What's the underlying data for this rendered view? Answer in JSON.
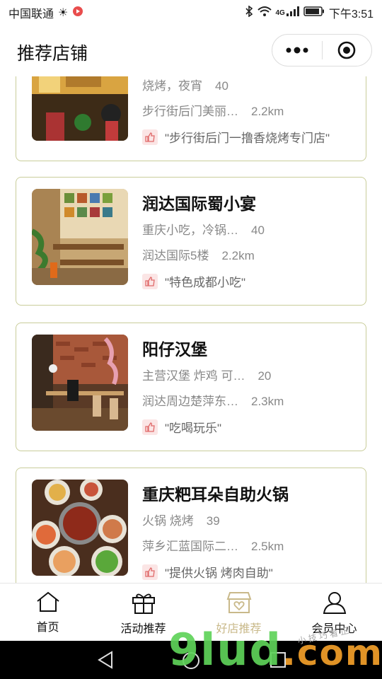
{
  "status_bar": {
    "carrier": "中国联通",
    "net": "4G",
    "time": "下午3:51"
  },
  "header": {
    "title": "推荐店铺"
  },
  "stores": [
    {
      "name": "",
      "tags": "烧烤，夜宵",
      "price": "40",
      "address": "步行街后门美丽…",
      "distance": "2.2km",
      "recommend": "\"步行街后门一撸香烧烤专门店\""
    },
    {
      "name": "润达国际蜀小宴",
      "tags": "重庆小吃，冷锅…",
      "price": "40",
      "address": "润达国际5楼",
      "distance": "2.2km",
      "recommend": "\"特色成都小吃\""
    },
    {
      "name": "阳仔汉堡",
      "tags": "主营汉堡 炸鸡 可…",
      "price": "20",
      "address": "润达周边楚萍东…",
      "distance": "2.3km",
      "recommend": "\"吃喝玩乐\""
    },
    {
      "name": "重庆粑耳朵自助火锅",
      "tags": "火锅 烧烤",
      "price": "39",
      "address": "萍乡汇蓝国际二…",
      "distance": "2.5km",
      "recommend": "\"提供火锅 烤肉自助\""
    }
  ],
  "tabs": [
    {
      "label": "首页",
      "icon": "home-icon"
    },
    {
      "label": "活动推荐",
      "icon": "gift-icon"
    },
    {
      "label": "好店推荐",
      "icon": "store-icon"
    },
    {
      "label": "会员中心",
      "icon": "user-icon"
    }
  ],
  "active_tab": "好店推荐",
  "watermark": {
    "main": "9lud",
    "suffix": ".com",
    "sub": "小 技 巧 看 正"
  },
  "colors": {
    "card_border": "#c9cd9a",
    "active_tab": "#c9b98a",
    "like_icon": "#e06a6a"
  }
}
